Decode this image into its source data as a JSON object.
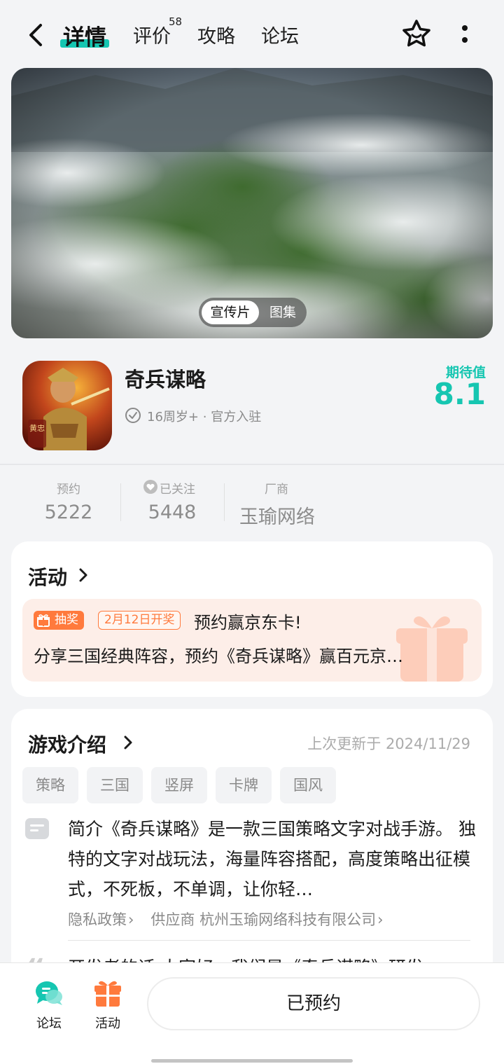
{
  "nav": {
    "tabs": [
      {
        "label": "详情",
        "active": true
      },
      {
        "label": "评价",
        "badge": "58"
      },
      {
        "label": "攻略"
      },
      {
        "label": "论坛"
      }
    ],
    "icons": [
      "back-icon",
      "star-icon",
      "more-icon"
    ]
  },
  "banner": {
    "toggle_active": "宣传片",
    "toggle_inactive": "图集"
  },
  "app": {
    "name": "奇兵谋略",
    "age": "16周岁+",
    "sep": "·",
    "official": "官方入驻",
    "expect_label": "期待值",
    "expect_value": "8.1",
    "icon_text": "黄忠"
  },
  "stats": [
    {
      "label": "预约",
      "value": "5222"
    },
    {
      "label": "已关注",
      "value": "5448"
    },
    {
      "label": "厂商",
      "value": "玉瑜网络"
    }
  ],
  "activity": {
    "title": "活动",
    "tag": "抽奖",
    "date_tag": "2月12日开奖",
    "headline": "预约赢京东卡!",
    "desc": "分享三国经典阵容，预约《奇兵谋略》赢百元京…"
  },
  "intro": {
    "title": "游戏介绍",
    "updated": "上次更新于 2024/11/29",
    "tags": [
      "策略",
      "三国",
      "竖屏",
      "卡牌",
      "国风"
    ],
    "text": "简介《奇兵谋略》是一款三国策略文字对战手游。 独特的文字对战玩法，海量阵容搭配，高度策略出征模式，不死板，不单调，让你轻…",
    "privacy": "隐私政策",
    "supplier": "供应商 杭州玉瑜网络科技有限公司",
    "dev_note": "开发者的话 大家好，我们是《奇兵谋略》研发"
  },
  "bottom": {
    "forum_label": "论坛",
    "activity_label": "活动",
    "reserved_label": "已预约"
  },
  "colors": {
    "accent": "#16c6b1",
    "orange": "#ff7a3d",
    "muted": "#8a8a8a"
  }
}
